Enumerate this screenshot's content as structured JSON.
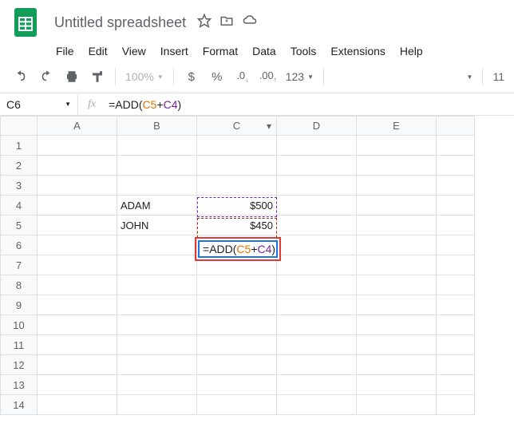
{
  "doc": {
    "title": "Untitled spreadsheet"
  },
  "menu": {
    "file": "File",
    "edit": "Edit",
    "view": "View",
    "insert": "Insert",
    "format": "Format",
    "data": "Data",
    "tools": "Tools",
    "extensions": "Extensions",
    "help": "Help"
  },
  "toolbar": {
    "zoom": "100%",
    "currency": "$",
    "percent": "%",
    "number_format": "123",
    "font_size": "11"
  },
  "name_box": "C6",
  "fx": "fx",
  "formula": {
    "eq": "=",
    "fn": "ADD",
    "open": "(",
    "ref1": "C5",
    "plus": "+",
    "ref2": "C4",
    "close": ")"
  },
  "columns": [
    "A",
    "B",
    "C",
    "D",
    "E"
  ],
  "rows": [
    "1",
    "2",
    "3",
    "4",
    "5",
    "6",
    "7",
    "8",
    "9",
    "10",
    "11",
    "12",
    "13",
    "14"
  ],
  "cells": {
    "B4": "ADAM",
    "B5": "JOHN",
    "C4": "$500",
    "C5": "$450"
  },
  "editing": {
    "cell": "C6",
    "display": "=ADD(C5+C4)"
  }
}
